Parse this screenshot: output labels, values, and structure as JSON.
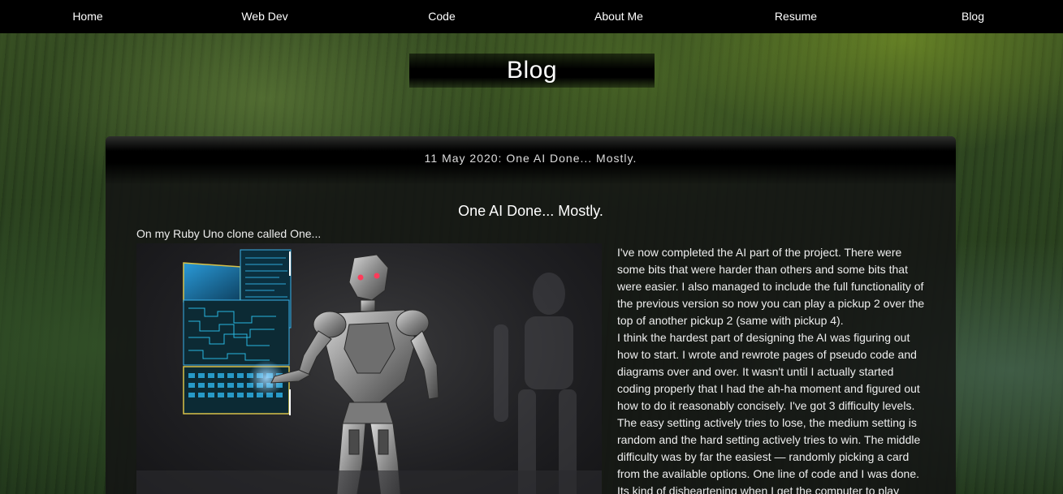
{
  "nav": {
    "items": [
      {
        "label": "Home"
      },
      {
        "label": "Web Dev"
      },
      {
        "label": "Code"
      },
      {
        "label": "About Me"
      },
      {
        "label": "Resume"
      },
      {
        "label": "Blog"
      }
    ]
  },
  "page": {
    "title": "Blog"
  },
  "post": {
    "header": "11 May 2020: One AI Done... Mostly.",
    "title": "One AI Done... Mostly.",
    "intro": "On my Ruby Uno clone called One...",
    "image_subject": "robot-touching-holographic-screen",
    "paragraphs": [
      "I've now completed the AI part of the project. There were some bits that were harder than others and some bits that were easier. I also managed to include the full functionality of the previous version so now you can play a pickup 2 over the top of another pickup 2 (same with pickup 4).",
      "I think the hardest part of designing the AI was figuring out how to start. I wrote and rewrote pages of pseudo code and diagrams over and over. It wasn't until I actually started coding properly that I had the ah-ha moment and figured out how to do it reasonably concisely. I've got 3 difficulty levels. The easy setting actively tries to lose, the medium setting is random and the hard setting actively tries to win. The middle difficulty was by far the easiest — randomly picking a card from the available options. One line of code and I was done. Its kind of disheartening when I get the computer to play"
    ]
  },
  "colors": {
    "nav_bg": "#000000",
    "panel_bg": "#141414",
    "text": "#ffffff"
  }
}
